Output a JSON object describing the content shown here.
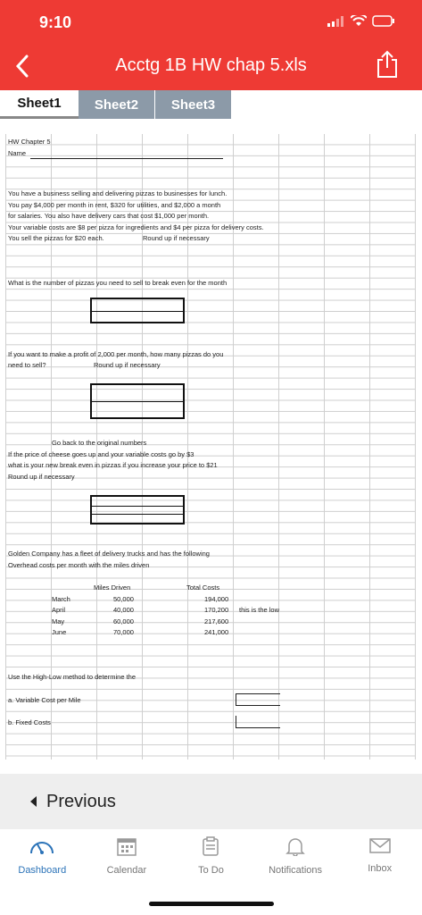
{
  "status": {
    "time": "9:10"
  },
  "header": {
    "title": "Acctg 1B HW chap 5.xls"
  },
  "tabs": [
    {
      "label": "Sheet1",
      "active": true
    },
    {
      "label": "Sheet2",
      "active": false
    },
    {
      "label": "Sheet3",
      "active": false
    }
  ],
  "sheet": {
    "hw_chapter": "HW Chapter 5",
    "name_label": "Name",
    "para1": [
      "You have a business selling and delivering pizzas to businesses for lunch.",
      "You pay $4,000 per month in rent, $320 for utilities, and $2,000 a month",
      "for salaries.  You also have delivery cars that cost $1,000 per month.",
      "Your variable costs are $8 per pizza for ingredients and $4 per pizza for delivery costs.",
      "You sell the pizzas for $20 each."
    ],
    "round_up_1": "Round up if necessary",
    "q1": "What is the number of pizzas you need to sell to break even for the month",
    "q2_line1": "If you want to make a profit of 2,000 per month, how many pizzas do you",
    "q2_line2": "need to sell?",
    "round_up_2": "Round up if necessary",
    "q3_lines": [
      "Go back to the original numbers",
      "If the price of cheese goes up and your variable costs go by $3",
      "what is your new break even in pizzas if you increase your price to $21",
      "Round up if necessary"
    ],
    "golden_line1": "Golden Company has a fleet of delivery trucks and has the following",
    "golden_line2": "Overhead costs per month with the miles driven",
    "table": {
      "headers": [
        "Miles Driven",
        "Total Costs"
      ],
      "rows": [
        {
          "month": "March",
          "miles": "50,000",
          "cost": "194,000",
          "note": ""
        },
        {
          "month": "April",
          "miles": "40,000",
          "cost": "170,200",
          "note": "this is the low"
        },
        {
          "month": "May",
          "miles": "60,000",
          "cost": "217,600",
          "note": ""
        },
        {
          "month": "June",
          "miles": "70,000",
          "cost": "241,000",
          "note": ""
        }
      ]
    },
    "hl_method": "Use the High-Low method to determine the",
    "var_cost": "a. Variable Cost per Mile",
    "fixed_cost": "b. Fixed Costs"
  },
  "previous": {
    "label": "Previous"
  },
  "nav": [
    {
      "label": "Dashboard",
      "icon": "dashboard-icon",
      "active": true
    },
    {
      "label": "Calendar",
      "icon": "calendar-icon",
      "active": false
    },
    {
      "label": "To Do",
      "icon": "todo-icon",
      "active": false
    },
    {
      "label": "Notifications",
      "icon": "bell-icon",
      "active": false
    },
    {
      "label": "Inbox",
      "icon": "inbox-icon",
      "active": false
    }
  ],
  "colors": {
    "header": "#ee3a34",
    "tab_inactive": "#8c9aa8",
    "nav_active": "#2b73b8"
  }
}
